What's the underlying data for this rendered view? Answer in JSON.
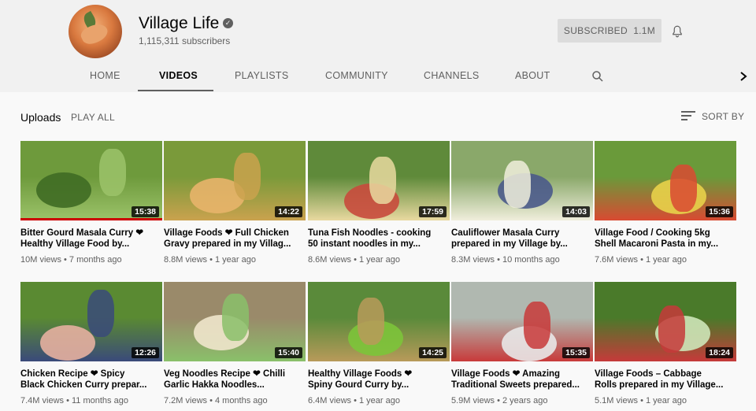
{
  "channel": {
    "name": "Village Life",
    "subscribers": "1,115,311 subscribers",
    "subscribed_label": "SUBSCRIBED",
    "subscriber_count_short": "1.1M"
  },
  "tabs": [
    {
      "label": "HOME"
    },
    {
      "label": "VIDEOS"
    },
    {
      "label": "PLAYLISTS"
    },
    {
      "label": "COMMUNITY"
    },
    {
      "label": "CHANNELS"
    },
    {
      "label": "ABOUT"
    }
  ],
  "active_tab": "VIDEOS",
  "section": {
    "title": "Uploads",
    "play_all": "PLAY ALL",
    "sort_by": "SORT BY"
  },
  "videos": [
    {
      "title_line1": "Bitter Gourd Masala Curry ❤",
      "title_line2": "Healthy Village Food by...",
      "meta": "10M views • 7 months ago",
      "duration": "15:38",
      "watched": 1.0,
      "palette": [
        "#6e9a3c",
        "#3f6b24",
        "#9cc36a"
      ]
    },
    {
      "title_line1": "Village Foods ❤ Full Chicken",
      "title_line2": "Gravy prepared in my Villag...",
      "meta": "8.8M views • 1 year ago",
      "duration": "14:22",
      "palette": [
        "#7a9a3a",
        "#e8b46a",
        "#caa24e"
      ]
    },
    {
      "title_line1": "Tuna Fish Noodles - cooking",
      "title_line2": "50 instant noodles in my...",
      "meta": "8.6M views • 1 year ago",
      "duration": "17:59",
      "palette": [
        "#5f8a3a",
        "#c84a3c",
        "#e9d9a0"
      ]
    },
    {
      "title_line1": "Cauliflower Masala Curry",
      "title_line2": "prepared in my Village by...",
      "meta": "8.3M views • 10 months ago",
      "duration": "14:03",
      "palette": [
        "#8aa86a",
        "#4a5a8a",
        "#f0eedc"
      ]
    },
    {
      "title_line1": "Village Food / Cooking 5kg",
      "title_line2": "Shell Macaroni Pasta in my...",
      "meta": "7.6M views • 1 year ago",
      "duration": "15:36",
      "palette": [
        "#6a9a3a",
        "#e8d24a",
        "#d94a32"
      ]
    },
    {
      "title_line1": "Chicken Recipe ❤ Spicy",
      "title_line2": "Black Chicken Curry prepar...",
      "meta": "7.4M views • 11 months ago",
      "duration": "12:26",
      "palette": [
        "#5a8a32",
        "#e6b0a0",
        "#3a4a7a"
      ]
    },
    {
      "title_line1": "Veg Noodles Recipe ❤ Chilli",
      "title_line2": "Garlic Hakka Noodles...",
      "meta": "7.2M views • 4 months ago",
      "duration": "15:40",
      "palette": [
        "#9a8a6a",
        "#efe6cc",
        "#8ac06a"
      ]
    },
    {
      "title_line1": "Healthy Village Foods ❤",
      "title_line2": "Spiny Gourd Curry by...",
      "meta": "6.4M views • 1 year ago",
      "duration": "14:25",
      "palette": [
        "#5a8a3a",
        "#7cc43a",
        "#b89a5a"
      ]
    },
    {
      "title_line1": "Village Foods ❤ Amazing",
      "title_line2": "Traditional Sweets prepared...",
      "meta": "5.9M views • 2 years ago",
      "duration": "15:35",
      "palette": [
        "#b0b8b0",
        "#e8e8e8",
        "#c83a3a"
      ]
    },
    {
      "title_line1": "Village Foods – Cabbage",
      "title_line2": "Rolls prepared in my Village...",
      "meta": "5.1M views • 1 year ago",
      "duration": "18:24",
      "palette": [
        "#4a7a2a",
        "#cde6b8",
        "#c63a3a"
      ]
    }
  ],
  "colors": {
    "header_bg": "#f1f1f1",
    "page_bg": "#f9f9f9",
    "progress_red": "#cc0000",
    "secondary_text": "#606060"
  },
  "icons": [
    "verified-icon",
    "bell-icon",
    "search-icon",
    "chevron-right-icon",
    "sort-icon"
  ]
}
